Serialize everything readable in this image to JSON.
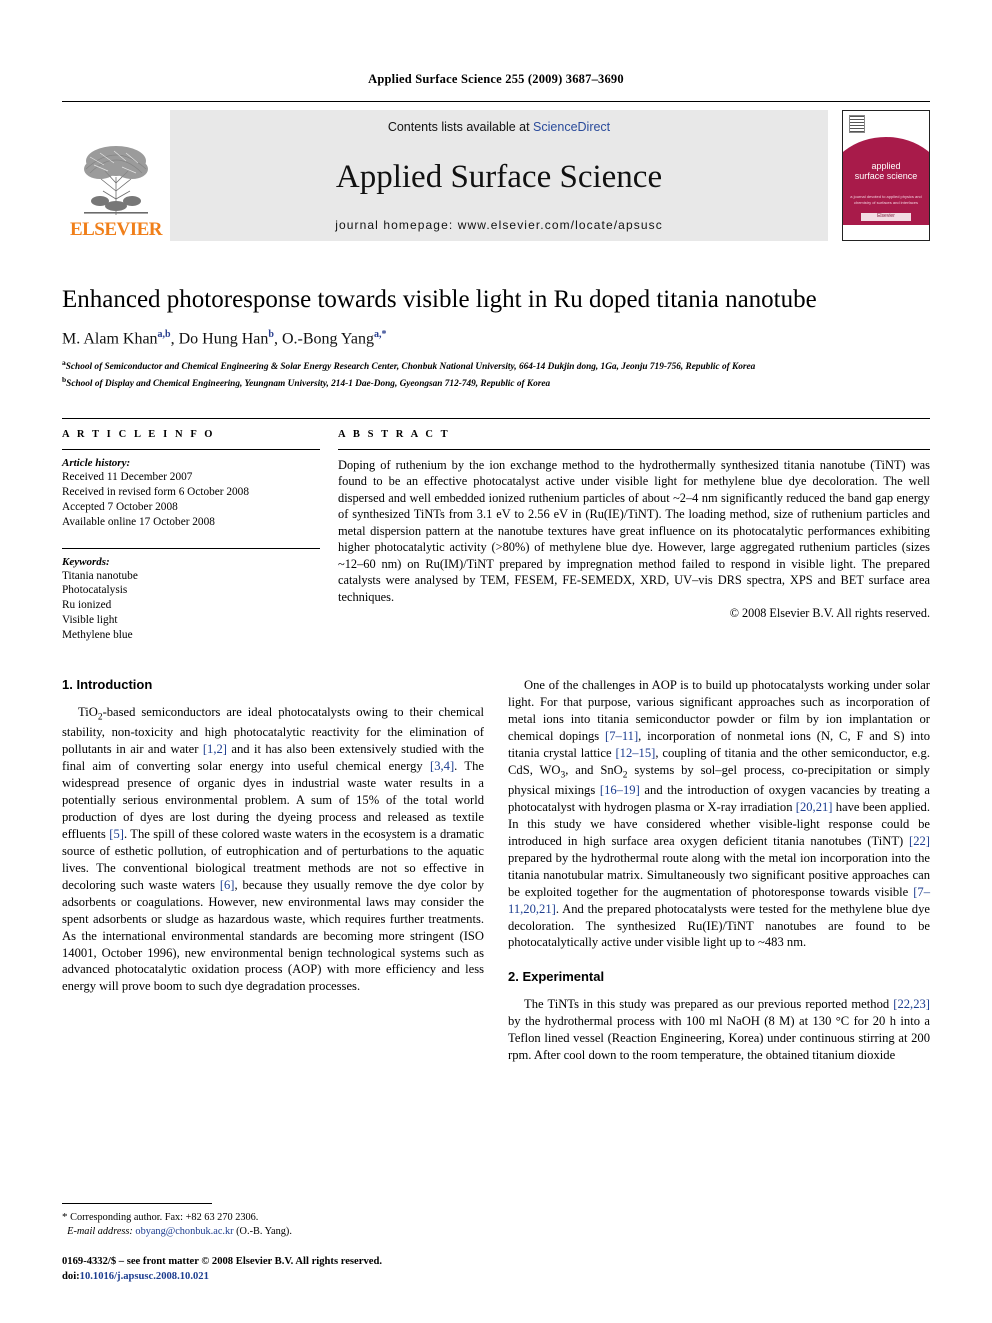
{
  "running_head": "Applied Surface Science 255 (2009) 3687–3690",
  "banner": {
    "publisher_name": "ELSEVIER",
    "contents_prefix": "Contents lists available at ",
    "contents_link": "ScienceDirect",
    "journal_name": "Applied Surface Science",
    "homepage": "journal homepage: www.elsevier.com/locate/apsusc",
    "cover": {
      "line1": "applied",
      "line2": "surface science",
      "sub": "a journal devoted to applied physics and chemistry of surfaces and interfaces",
      "foot": "Elsevier"
    }
  },
  "article": {
    "title": "Enhanced photoresponse towards visible light in Ru doped titania nanotube",
    "authors_plain": "M. Alam Khan a,b, Do Hung Han b, O.-Bong Yang a,*",
    "authors": [
      {
        "name": "M. Alam Khan",
        "marks": "a,b",
        "sep": ", "
      },
      {
        "name": "Do Hung Han",
        "marks": "b",
        "sep": ", "
      },
      {
        "name": "O.-Bong Yang",
        "marks": "a,*",
        "sep": ""
      }
    ],
    "affiliations": [
      {
        "mark": "a",
        "text": "School of Semiconductor and Chemical Engineering & Solar Energy Research Center, Chonbuk National University, 664-14 Dukjin dong, 1Ga, Jeonju 719-756, Republic of Korea"
      },
      {
        "mark": "b",
        "text": "School of Display and Chemical Engineering, Yeungnam University, 214-1 Dae-Dong, Gyeongsan 712-749, Republic of Korea"
      }
    ]
  },
  "article_info": {
    "label": "A R T I C L E  I N F O",
    "history_heading": "Article history:",
    "history": [
      "Received 11 December 2007",
      "Received in revised form 6 October 2008",
      "Accepted 7 October 2008",
      "Available online 17 October 2008"
    ],
    "keywords_heading": "Keywords:",
    "keywords": [
      "Titania nanotube",
      "Photocatalysis",
      "Ru ionized",
      "Visible light",
      "Methylene blue"
    ]
  },
  "abstract": {
    "label": "A B S T R A C T",
    "text": "Doping of ruthenium by the ion exchange method to the hydrothermally synthesized titania nanotube (TiNT) was found to be an effective photocatalyst active under visible light for methylene blue dye decoloration. The well dispersed and well embedded ionized ruthenium particles of about ~2–4 nm significantly reduced the band gap energy of synthesized TiNTs from 3.1 eV to 2.56 eV in (Ru(IE)/TiNT). The loading method, size of ruthenium particles and metal dispersion pattern at the nanotube textures have great influence on its photocatalytic performances exhibiting higher photocatalytic activity (>80%) of methylene blue dye. However, large aggregated ruthenium particles (sizes ~12–60 nm) on Ru(IM)/TiNT prepared by impregnation method failed to respond in visible light. The prepared catalysts were analysed by TEM, FESEM, FE-SEMEDX, XRD, UV–vis DRS spectra, XPS and BET surface area techniques.",
    "copyright": "© 2008 Elsevier B.V. All rights reserved."
  },
  "sections": {
    "introduction_title": "1. Introduction",
    "experimental_title": "2. Experimental",
    "intro_p1": "TiO2-based semiconductors are ideal photocatalysts owing to their chemical stability, non-toxicity and high photocatalytic reactivity for the elimination of pollutants in air and water [1,2] and it has also been extensively studied with the final aim of converting solar energy into useful chemical energy [3,4]. The widespread presence of organic dyes in industrial waste water results in a potentially serious environmental problem. A sum of 15% of the total world production of dyes are lost during the dyeing process and released as textile effluents [5]. The spill of these colored waste waters in the ecosystem is a dramatic source of esthetic pollution, of eutrophication and of perturbations to the aquatic lives. The conventional biological treatment methods are not so effective in decoloring such waste waters [6], because they usually remove the dye color by adsorbents or coagulations. However, new environmental laws may consider the spent adsorbents or sludge as hazardous waste, which requires further treatments. As the international environmental standards are becoming more stringent (ISO 14001, October 1996), new environmental benign technological systems such as advanced photocatalytic oxidation process (AOP) with more efficiency and less energy will prove boom to such dye degradation processes.",
    "intro_p2": "One of the challenges in AOP is to build up photocatalysts working under solar light. For that purpose, various significant approaches such as incorporation of metal ions into titania semiconductor powder or film by ion implantation or chemical dopings [7–11], incorporation of nonmetal ions (N, C, F and S) into titania crystal lattice [12–15], coupling of titania and the other semiconductor, e.g. CdS, WO3, and SnO2 systems by sol–gel process, co-precipitation or simply physical mixings [16–19] and the introduction of oxygen vacancies by treating a photocatalyst with hydrogen plasma or X-ray irradiation [20,21] have been applied. In this study we have considered whether visible-light response could be introduced in high surface area oxygen deficient titania nanotubes (TiNT) [22] prepared by the hydrothermal route along with the metal ion incorporation into the titania nanotubular matrix. Simultaneously two significant positive approaches can be exploited together for the augmentation of photoresponse towards visible [7–11,20,21]. And the prepared photocatalysts were tested for the methylene blue dye decoloration. The synthesized Ru(IE)/TiNT nanotubes are found to be photocatalytically active under visible light up to ~483 nm.",
    "exp_p1": "The TiNTs in this study was prepared as our previous reported method [22,23] by the hydrothermal process with 100 ml NaOH (8 M) at 130 °C for 20 h into a Teflon lined vessel (Reaction Engineering, Korea) under continuous stirring at 200 rpm. After cool down to the room temperature, the obtained titanium dioxide"
  },
  "footnotes": {
    "corresponding": "Corresponding author. Fax: +82 63 270 2306.",
    "email_label": "E-mail address:",
    "email": "obyang@chonbuk.ac.kr",
    "email_owner": "(O.-B. Yang).",
    "issn_line": "0169-4332/$ – see front matter © 2008 Elsevier B.V. All rights reserved.",
    "doi_label": "doi:",
    "doi_value": "10.1016/j.apsusc.2008.10.021"
  },
  "colors": {
    "elsevier_orange": "#F07F1A",
    "link_blue": "#1c3d8f",
    "sciencedirect_blue": "#2a4b9b",
    "cover_magenta": "#a81b4a",
    "banner_gray": "#e8e8e8"
  }
}
